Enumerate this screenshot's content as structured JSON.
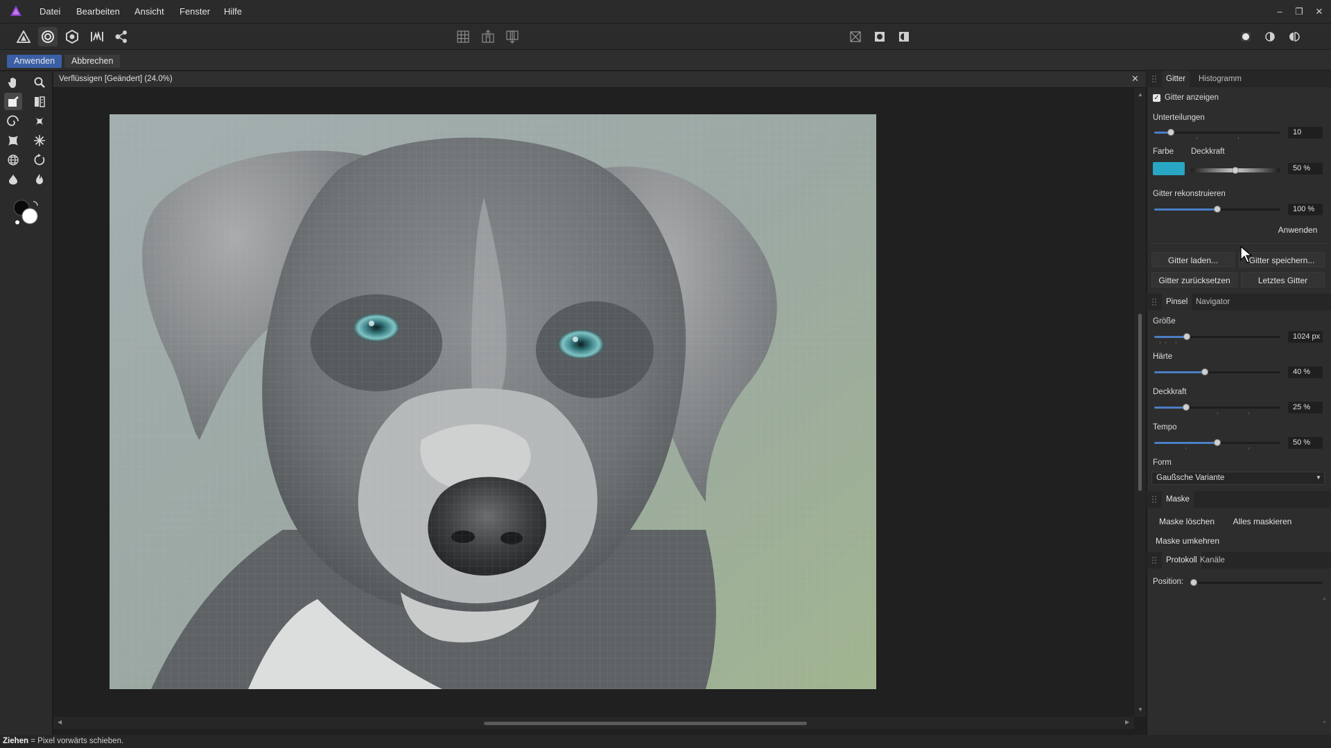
{
  "menubar": {
    "logo_icon": "affinity-photo-logo",
    "items": [
      "Datei",
      "Bearbeiten",
      "Ansicht",
      "Fenster",
      "Hilfe"
    ],
    "window_controls": [
      "minimize",
      "restore",
      "close"
    ]
  },
  "toolbar": {
    "personas": [
      "photo-persona-icon",
      "liquify-persona-icon",
      "develop-persona-icon",
      "tone-mapping-persona-icon",
      "export-persona-icon"
    ],
    "selected_persona": 1,
    "center_icons": [
      "grid-icon",
      "grid-expand-icon",
      "grid-collapse-icon"
    ],
    "right_icons": [
      "mask-off-icon",
      "mask-on-icon",
      "invert-mask-icon"
    ],
    "view_icons": [
      "view-single-icon",
      "view-split-icon",
      "view-mirror-icon"
    ]
  },
  "context": {
    "apply_label": "Anwenden",
    "cancel_label": "Abbrechen"
  },
  "tools": {
    "items": [
      "hand-tool-icon",
      "zoom-tool-icon",
      "push-forward-tool-icon",
      "push-left-tool-icon",
      "twirl-tool-icon",
      "pinch-tool-icon",
      "punch-tool-icon",
      "turbulence-tool-icon",
      "mesh-clone-tool-icon",
      "reconstruct-tool-icon",
      "freeze-tool-icon",
      "thaw-tool-icon"
    ],
    "selected": 2,
    "color_swatch": "primary-secondary-color-icon"
  },
  "document": {
    "title": "Verflüssigen [Geändert] (24.0%)",
    "close_icon": "close-icon"
  },
  "panel_grid": {
    "tabs": [
      "Gitter",
      "Histogramm"
    ],
    "show_grid_label": "Gitter anzeigen",
    "show_grid_checked": true,
    "subdivisions_label": "Unterteilungen",
    "subdivisions_value": "10",
    "subdivisions_level": 0.13,
    "color_label": "Farbe",
    "color_value": "#29a6c4",
    "opacity_label": "Deckkraft",
    "opacity_value": "50 %",
    "opacity_level": 0.5,
    "reconstruct_label": "Gitter rekonstruieren",
    "reconstruct_value": "100 %",
    "reconstruct_level": 0.5,
    "apply_label": "Anwenden",
    "load_label": "Gitter laden...",
    "save_label": "Gitter speichern...",
    "reset_label": "Gitter zurücksetzen",
    "last_label": "Letztes Gitter"
  },
  "panel_brush": {
    "tabs": [
      "Pinsel",
      "Navigator"
    ],
    "size_label": "Größe",
    "size_value": "1024 px",
    "size_level": 0.26,
    "hardness_label": "Härte",
    "hardness_value": "40 %",
    "hardness_level": 0.4,
    "opacity_label": "Deckkraft",
    "opacity_value": "25 %",
    "opacity_level": 0.25,
    "speed_label": "Tempo",
    "speed_value": "50 %",
    "speed_level": 0.5,
    "form_label": "Form",
    "form_value": "Gaußsche Variante"
  },
  "panel_mask": {
    "title": "Maske",
    "clear_label": "Maske löschen",
    "mask_all_label": "Alles maskieren",
    "invert_label": "Maske umkehren"
  },
  "panel_history": {
    "tabs": [
      "Protokoll",
      "Kanäle"
    ],
    "position_label": "Position:",
    "position_level": 0
  },
  "statusbar": {
    "bold": "Ziehen",
    "text": " = Pixel vorwärts schieben."
  },
  "colors": {
    "accent": "#4b7ec6",
    "apply_button": "#3a5fa6",
    "grid_color": "#29a6c4"
  }
}
